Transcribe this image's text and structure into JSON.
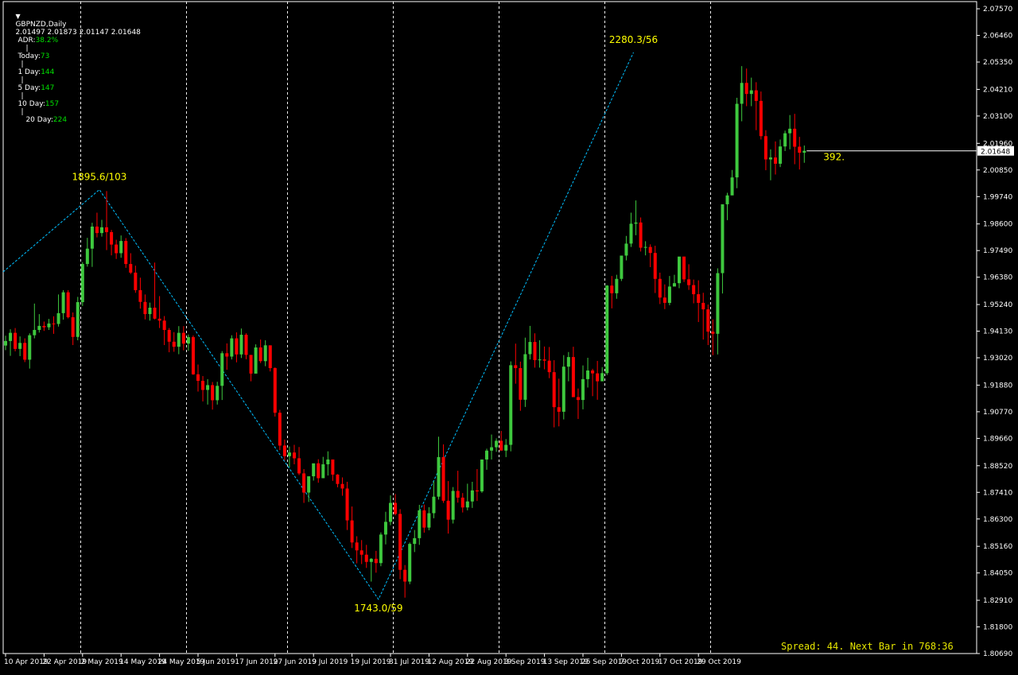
{
  "header": {
    "menu_icon": "triangle-down-icon",
    "symbol": "GBPNZD,Daily",
    "ohlc": "2.01497 2.01873 2.01147 2.01648"
  },
  "adr": {
    "adr_label": "ADR:",
    "adr_value": "38.2%",
    "today_label": "Today:",
    "today_value": "73",
    "d1_label": "1 Day:",
    "d1_value": "144",
    "d5_label": "5 Day:",
    "d5_value": "147",
    "d10_label": "10 Day:",
    "d10_value": "157",
    "d20_label": "20 Day:",
    "d20_value": "224",
    "label_color": "#ffffff",
    "value_color": "#00e000"
  },
  "status": {
    "spread_text": "Spread: 44. Next Bar in 768:36",
    "color": "#e6e600"
  },
  "colors": {
    "background": "#000000",
    "bull": "#3ec83e",
    "bear": "#ff0000",
    "zigzag": "#00bfff",
    "label": "#ffff00",
    "grid": "#ffffff"
  },
  "chart_data": {
    "type": "candlestick",
    "symbol": "GBPNZD",
    "timeframe": "Daily",
    "y_axis_ticks": [
      "2.07570",
      "2.06460",
      "2.05350",
      "2.04210",
      "2.03100",
      "2.01960",
      "2.00850",
      "1.99740",
      "1.98600",
      "1.97490",
      "1.96380",
      "1.95240",
      "1.94130",
      "1.93020",
      "1.91880",
      "1.90770",
      "1.89660",
      "1.88520",
      "1.87410",
      "1.86300",
      "1.85160",
      "1.84050",
      "1.82910",
      "1.81800",
      "1.80690"
    ],
    "ylim": [
      1.8069,
      2.0787
    ],
    "current_price": "2.01648",
    "x_axis_labels": [
      "10 Apr 2019",
      "22 Apr 2019",
      "2 May 2019",
      "14 May 2019",
      "24 May 2019",
      "5 Jun 2019",
      "17 Jun 2019",
      "27 Jun 2019",
      "9 Jul 2019",
      "19 Jul 2019",
      "31 Jul 2019",
      "12 Aug 2019",
      "22 Aug 2019",
      "3 Sep 2019",
      "13 Sep 2019",
      "25 Sep 2019",
      "7 Oct 2019",
      "17 Oct 2019",
      "29 Oct 2019"
    ],
    "x_label_index": [
      0,
      8,
      16,
      24,
      32,
      40,
      48,
      56,
      64,
      72,
      80,
      88,
      96,
      104,
      112,
      120,
      128,
      136,
      144
    ],
    "period_separators_index": [
      15.5,
      37.5,
      58.5,
      80.5,
      102.5,
      124.5,
      146.5
    ],
    "zigzag": [
      {
        "i": -0.5,
        "price": 1.966
      },
      {
        "i": 19.5,
        "price": 2.0003
      },
      {
        "i": 77.5,
        "price": 1.8295
      },
      {
        "i": 130.5,
        "price": 2.0575
      }
    ],
    "zigzag_labels": [
      {
        "text": "1895.6/103",
        "i": 19.5,
        "price": 2.0003,
        "pos": "above"
      },
      {
        "text": "1743.0/59",
        "i": 77.5,
        "price": 1.8295,
        "pos": "below"
      },
      {
        "text": "2280.3/56",
        "i": 130.5,
        "price": 2.0575,
        "pos": "above"
      }
    ],
    "open_price_label": "392.",
    "candles": [
      [
        1.9353,
        1.9394,
        1.9334,
        1.9372
      ],
      [
        1.9372,
        1.9421,
        1.931,
        1.9406
      ],
      [
        1.9406,
        1.9426,
        1.9329,
        1.9339
      ],
      [
        1.9339,
        1.9391,
        1.9309,
        1.9364
      ],
      [
        1.9364,
        1.9383,
        1.9284,
        1.9294
      ],
      [
        1.9294,
        1.9404,
        1.9257,
        1.9396
      ],
      [
        1.9396,
        1.9528,
        1.9383,
        1.9418
      ],
      [
        1.9418,
        1.9484,
        1.9407,
        1.9435
      ],
      [
        1.9435,
        1.9453,
        1.9414,
        1.9429
      ],
      [
        1.9429,
        1.9464,
        1.9418,
        1.9445
      ],
      [
        1.9445,
        1.9475,
        1.9402,
        1.9443
      ],
      [
        1.9443,
        1.9566,
        1.9432,
        1.9488
      ],
      [
        1.9488,
        1.9584,
        1.9461,
        1.9575
      ],
      [
        1.9575,
        1.9584,
        1.9466,
        1.9471
      ],
      [
        1.9471,
        1.9491,
        1.9355,
        1.9389
      ],
      [
        1.9389,
        1.9556,
        1.9375,
        1.9534
      ],
      [
        1.9534,
        1.9701,
        1.9518,
        1.9693
      ],
      [
        1.9693,
        1.9802,
        1.9682,
        1.9757
      ],
      [
        1.9757,
        1.9865,
        1.9681,
        1.9849
      ],
      [
        1.9849,
        1.9907,
        1.9804,
        1.9822
      ],
      [
        1.9822,
        1.9877,
        1.9807,
        1.9846
      ],
      [
        1.9846,
        1.9997,
        1.9751,
        1.9826
      ],
      [
        1.9826,
        1.9835,
        1.9729,
        1.9774
      ],
      [
        1.9774,
        1.9794,
        1.9714,
        1.9738
      ],
      [
        1.9738,
        1.9812,
        1.9719,
        1.9789
      ],
      [
        1.9789,
        1.9801,
        1.9677,
        1.9693
      ],
      [
        1.9693,
        1.9738,
        1.9651,
        1.9657
      ],
      [
        1.9657,
        1.9686,
        1.9573,
        1.9584
      ],
      [
        1.9584,
        1.9636,
        1.9507,
        1.9535
      ],
      [
        1.9535,
        1.9566,
        1.9462,
        1.9484
      ],
      [
        1.9484,
        1.9532,
        1.9457,
        1.9511
      ],
      [
        1.9511,
        1.9699,
        1.9462,
        1.9465
      ],
      [
        1.9465,
        1.9559,
        1.9426,
        1.9457
      ],
      [
        1.9457,
        1.9476,
        1.9355,
        1.9418
      ],
      [
        1.9418,
        1.9426,
        1.9325,
        1.9369
      ],
      [
        1.9369,
        1.9409,
        1.9327,
        1.9348
      ],
      [
        1.9348,
        1.9434,
        1.9317,
        1.9406
      ],
      [
        1.9406,
        1.9434,
        1.9333,
        1.9361
      ],
      [
        1.9361,
        1.9399,
        1.9331,
        1.9388
      ],
      [
        1.9388,
        1.9395,
        1.9231,
        1.9233
      ],
      [
        1.9233,
        1.9274,
        1.9161,
        1.9206
      ],
      [
        1.9206,
        1.9226,
        1.912,
        1.9168
      ],
      [
        1.9168,
        1.9213,
        1.9107,
        1.9188
      ],
      [
        1.9188,
        1.9201,
        1.9086,
        1.9125
      ],
      [
        1.9125,
        1.9202,
        1.9107,
        1.9185
      ],
      [
        1.9185,
        1.933,
        1.9126,
        1.9321
      ],
      [
        1.9321,
        1.9362,
        1.9252,
        1.9307
      ],
      [
        1.9307,
        1.9396,
        1.9295,
        1.9383
      ],
      [
        1.9383,
        1.9408,
        1.9283,
        1.9316
      ],
      [
        1.9316,
        1.9424,
        1.9301,
        1.9398
      ],
      [
        1.9398,
        1.9404,
        1.9296,
        1.9314
      ],
      [
        1.9314,
        1.931,
        1.9204,
        1.9236
      ],
      [
        1.9236,
        1.9358,
        1.9244,
        1.9345
      ],
      [
        1.9345,
        1.9378,
        1.928,
        1.9288
      ],
      [
        1.9288,
        1.9375,
        1.9267,
        1.9354
      ],
      [
        1.9354,
        1.9335,
        1.9245,
        1.9259
      ],
      [
        1.9259,
        1.9262,
        1.9057,
        1.9073
      ],
      [
        1.9073,
        1.9085,
        1.8917,
        1.8936
      ],
      [
        1.8936,
        1.8961,
        1.8874,
        1.8892
      ],
      [
        1.8892,
        1.8932,
        1.8845,
        1.8907
      ],
      [
        1.8907,
        1.8939,
        1.8858,
        1.8883
      ],
      [
        1.8883,
        1.893,
        1.8813,
        1.882
      ],
      [
        1.882,
        1.8838,
        1.8697,
        1.874
      ],
      [
        1.874,
        1.8775,
        1.8701,
        1.8808
      ],
      [
        1.8808,
        1.8841,
        1.879,
        1.8862
      ],
      [
        1.8862,
        1.8879,
        1.8781,
        1.88
      ],
      [
        1.88,
        1.8889,
        1.8806,
        1.8858
      ],
      [
        1.8858,
        1.8912,
        1.8811,
        1.8878
      ],
      [
        1.8878,
        1.8862,
        1.8789,
        1.8815
      ],
      [
        1.8815,
        1.8817,
        1.8762,
        1.8776
      ],
      [
        1.8776,
        1.8803,
        1.8727,
        1.8757
      ],
      [
        1.8757,
        1.8785,
        1.8584,
        1.8624
      ],
      [
        1.8624,
        1.8682,
        1.8509,
        1.8532
      ],
      [
        1.8532,
        1.8558,
        1.8445,
        1.8499
      ],
      [
        1.8499,
        1.8542,
        1.8442,
        1.8481
      ],
      [
        1.8481,
        1.8522,
        1.8426,
        1.8451
      ],
      [
        1.8451,
        1.8467,
        1.8369,
        1.8464
      ],
      [
        1.8464,
        1.8497,
        1.8406,
        1.8446
      ],
      [
        1.8446,
        1.8574,
        1.8433,
        1.8565
      ],
      [
        1.8565,
        1.866,
        1.8524,
        1.8618
      ],
      [
        1.8618,
        1.8728,
        1.8604,
        1.8697
      ],
      [
        1.8697,
        1.8734,
        1.8645,
        1.8651
      ],
      [
        1.8651,
        1.8671,
        1.8379,
        1.8418
      ],
      [
        1.8418,
        1.8438,
        1.8302,
        1.8369
      ],
      [
        1.8369,
        1.8532,
        1.8358,
        1.8526
      ],
      [
        1.8526,
        1.8584,
        1.8492,
        1.855
      ],
      [
        1.855,
        1.8689,
        1.8522,
        1.8666
      ],
      [
        1.8666,
        1.869,
        1.8573,
        1.8594
      ],
      [
        1.8594,
        1.8679,
        1.8583,
        1.8654
      ],
      [
        1.8654,
        1.8787,
        1.8633,
        1.8723
      ],
      [
        1.8723,
        1.8973,
        1.8711,
        1.8888
      ],
      [
        1.8888,
        1.8941,
        1.8697,
        1.8706
      ],
      [
        1.8706,
        1.8788,
        1.8569,
        1.8627
      ],
      [
        1.8627,
        1.8763,
        1.8611,
        1.8747
      ],
      [
        1.8747,
        1.8831,
        1.8698,
        1.8719
      ],
      [
        1.8719,
        1.8738,
        1.8657,
        1.8678
      ],
      [
        1.8678,
        1.8777,
        1.8666,
        1.8703
      ],
      [
        1.8703,
        1.8785,
        1.8676,
        1.8749
      ],
      [
        1.8749,
        1.8838,
        1.8705,
        1.8745
      ],
      [
        1.8745,
        1.8876,
        1.8739,
        1.8878
      ],
      [
        1.8878,
        1.8923,
        1.8835,
        1.8915
      ],
      [
        1.8915,
        1.8982,
        1.8878,
        1.8929
      ],
      [
        1.8929,
        1.8966,
        1.891,
        1.8956
      ],
      [
        1.8956,
        1.8997,
        1.8925,
        1.8915
      ],
      [
        1.8915,
        1.8963,
        1.8888,
        1.8939
      ],
      [
        1.8939,
        1.9287,
        1.8912,
        1.9271
      ],
      [
        1.9271,
        1.9361,
        1.9194,
        1.9259
      ],
      [
        1.9259,
        1.9286,
        1.9081,
        1.9127
      ],
      [
        1.9127,
        1.9386,
        1.9097,
        1.9317
      ],
      [
        1.9317,
        1.9435,
        1.9295,
        1.9368
      ],
      [
        1.9368,
        1.9404,
        1.9261,
        1.9292
      ],
      [
        1.9292,
        1.9375,
        1.9261,
        1.9295
      ],
      [
        1.9295,
        1.9349,
        1.9254,
        1.929
      ],
      [
        1.929,
        1.9347,
        1.9217,
        1.9242
      ],
      [
        1.9242,
        1.9292,
        1.9012,
        1.9096
      ],
      [
        1.9096,
        1.9215,
        1.9016,
        1.9077
      ],
      [
        1.9077,
        1.9313,
        1.9045,
        1.9265
      ],
      [
        1.9265,
        1.9326,
        1.9204,
        1.9305
      ],
      [
        1.9305,
        1.9348,
        1.9189,
        1.9138
      ],
      [
        1.9138,
        1.9174,
        1.9047,
        1.9126
      ],
      [
        1.9126,
        1.927,
        1.9087,
        1.9213
      ],
      [
        1.9213,
        1.9302,
        1.9178,
        1.9249
      ],
      [
        1.9249,
        1.9256,
        1.9142,
        1.9237
      ],
      [
        1.9237,
        1.9289,
        1.9127,
        1.9204
      ],
      [
        1.9204,
        1.9263,
        1.9205,
        1.9238
      ],
      [
        1.9238,
        1.9605,
        1.923,
        1.9603
      ],
      [
        1.9603,
        1.9643,
        1.9508,
        1.9571
      ],
      [
        1.9571,
        1.9648,
        1.9548,
        1.9631
      ],
      [
        1.9631,
        1.9722,
        1.9622,
        1.9728
      ],
      [
        1.9728,
        1.981,
        1.9708,
        1.9778
      ],
      [
        1.9778,
        1.9907,
        1.9764,
        1.9861
      ],
      [
        1.9861,
        1.9958,
        1.9813,
        1.9866
      ],
      [
        1.9866,
        1.9887,
        1.9745,
        1.9761
      ],
      [
        1.9761,
        1.9788,
        1.9729,
        1.9764
      ],
      [
        1.9764,
        1.9775,
        1.968,
        1.9739
      ],
      [
        1.9739,
        1.9769,
        1.9572,
        1.9631
      ],
      [
        1.9631,
        1.9657,
        1.9526,
        1.9553
      ],
      [
        1.9553,
        1.9608,
        1.9505,
        1.9531
      ],
      [
        1.9531,
        1.9643,
        1.9521,
        1.9599
      ],
      [
        1.9599,
        1.9648,
        1.9603,
        1.9613
      ],
      [
        1.9613,
        1.9714,
        1.9592,
        1.9724
      ],
      [
        1.9724,
        1.9694,
        1.9618,
        1.9629
      ],
      [
        1.9629,
        1.9692,
        1.9585,
        1.9605
      ],
      [
        1.9605,
        1.9628,
        1.9529,
        1.9567
      ],
      [
        1.9567,
        1.9625,
        1.9451,
        1.9531
      ],
      [
        1.9531,
        1.9573,
        1.9378,
        1.9504
      ],
      [
        1.9504,
        1.9524,
        1.9355,
        1.9411
      ],
      [
        1.9411,
        1.9462,
        1.9313,
        1.9402
      ],
      [
        1.9402,
        1.9675,
        1.9316,
        1.9655
      ],
      [
        1.9655,
        1.9801,
        1.957,
        1.9942
      ],
      [
        1.9942,
        1.999,
        1.9876,
        1.9979
      ],
      [
        1.9979,
        2.0085,
        1.9986,
        2.0054
      ],
      [
        2.0054,
        2.0386,
        2.0009,
        2.0361
      ],
      [
        2.0361,
        2.0518,
        2.0288,
        2.0448
      ],
      [
        2.0448,
        2.0508,
        2.0351,
        2.0402
      ],
      [
        2.0402,
        2.047,
        2.0351,
        2.0417
      ],
      [
        2.0417,
        2.0451,
        2.0251,
        2.0373
      ],
      [
        2.0373,
        2.0412,
        2.0212,
        2.0226
      ],
      [
        2.0226,
        2.0251,
        2.0084,
        2.0129
      ],
      [
        2.0129,
        2.0171,
        2.0042,
        2.0137
      ],
      [
        2.0137,
        2.0204,
        2.0066,
        2.0111
      ],
      [
        2.0111,
        2.0212,
        2.0097,
        2.0183
      ],
      [
        2.0183,
        2.0249,
        2.0164,
        2.0238
      ],
      [
        2.0238,
        2.0314,
        2.0171,
        2.0257
      ],
      [
        2.0257,
        2.0319,
        2.0109,
        2.0182
      ],
      [
        2.0182,
        2.0223,
        2.0087,
        2.0157
      ],
      [
        2.0157,
        2.0187,
        2.0115,
        2.0165
      ]
    ]
  }
}
